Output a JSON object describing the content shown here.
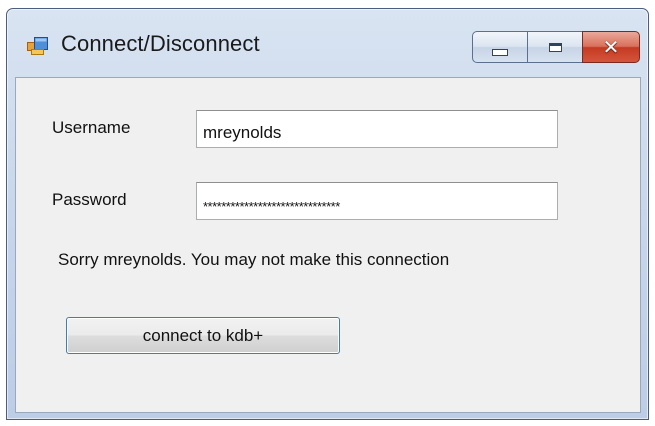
{
  "window": {
    "title": "Connect/Disconnect",
    "icon": "app-window-icon",
    "caption_buttons": [
      "minimize-icon",
      "maximize-icon",
      "close-icon"
    ]
  },
  "form": {
    "username_label": "Username",
    "username_value": "mreynolds",
    "password_label": "Password",
    "password_value": "******************************",
    "status_message": "Sorry mreynolds. You may not make this connection",
    "connect_button_label": "connect to kdb+"
  },
  "colors": {
    "close_button": "#c43a22",
    "button_focus_border": "#3c7fb1",
    "client_background": "#f0f0f0"
  }
}
